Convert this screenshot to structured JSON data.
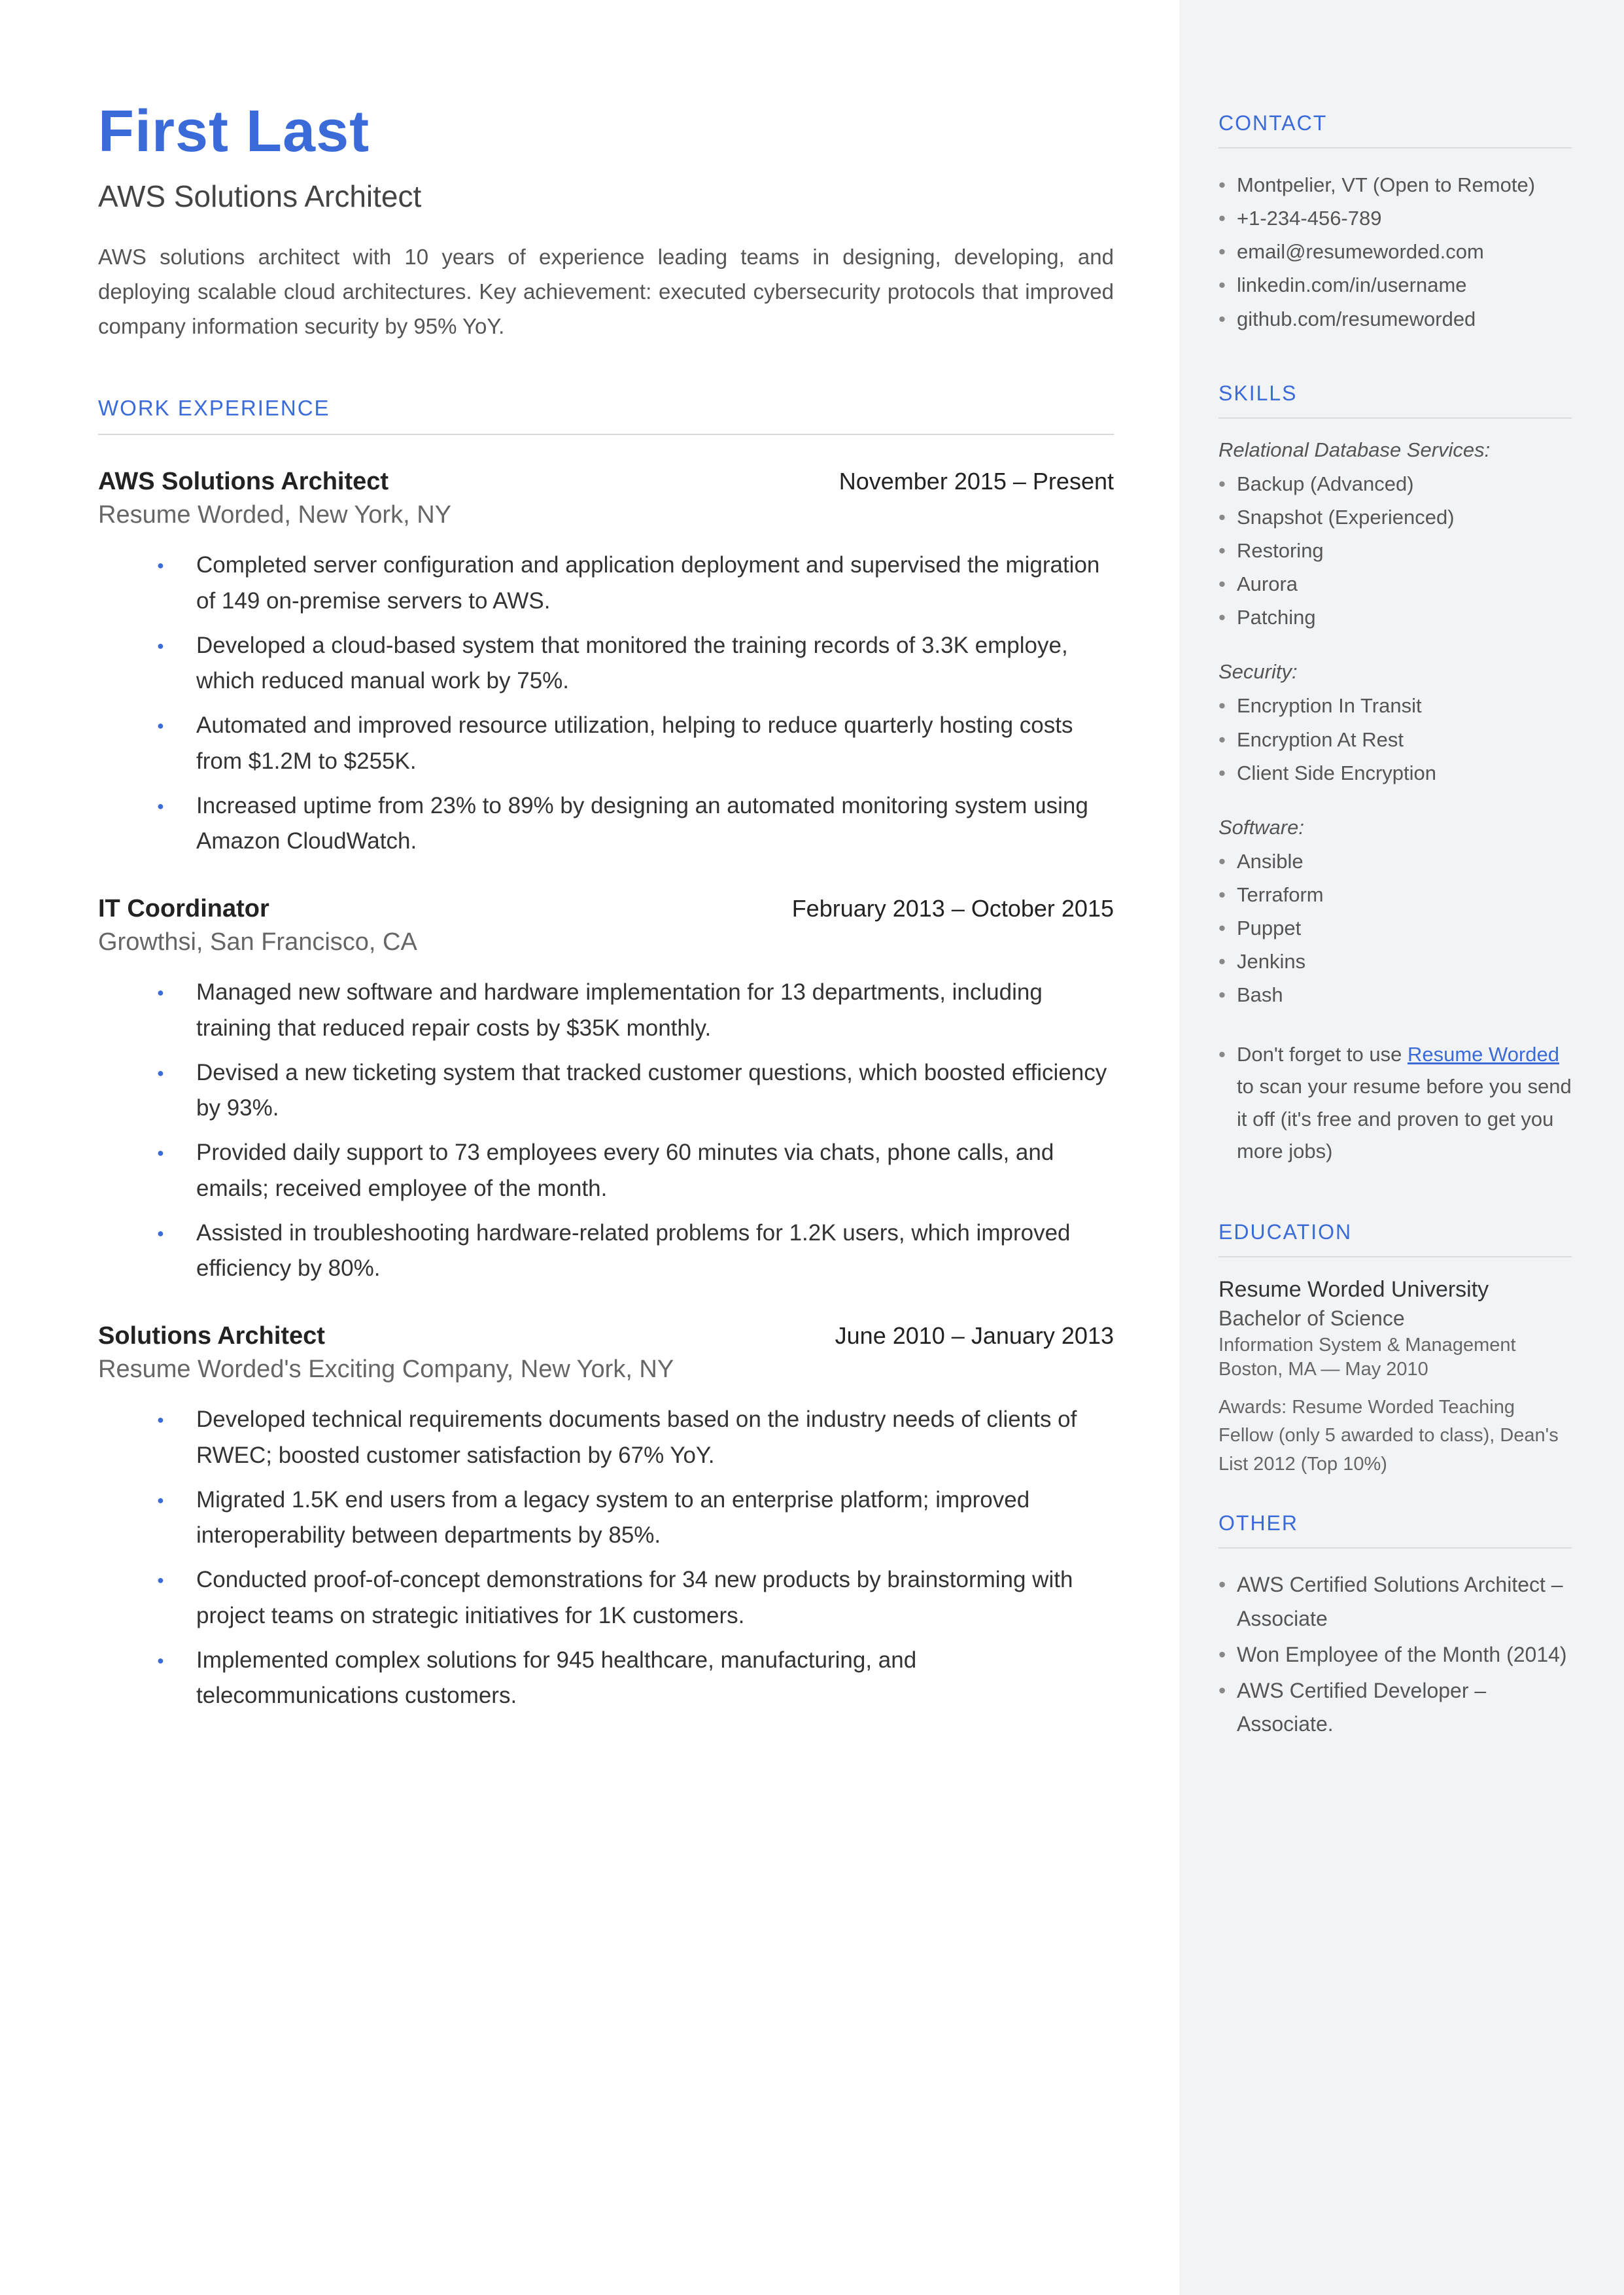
{
  "header": {
    "name": "First Last",
    "title": "AWS Solutions Architect",
    "summary": "AWS solutions architect with 10 years of experience leading teams in designing, developing, and deploying scalable cloud architectures. Key achievement: executed cybersecurity protocols that improved company information security by 95% YoY."
  },
  "sections": {
    "work": "WORK EXPERIENCE",
    "contact": "CONTACT",
    "skills": "SKILLS",
    "education": "EDUCATION",
    "other": "OTHER"
  },
  "jobs": [
    {
      "title": "AWS Solutions Architect",
      "dates": "November 2015 – Present",
      "company": "Resume Worded, New York, NY",
      "bullets": [
        "Completed server configuration and application deployment and supervised the migration of 149 on-premise servers to AWS.",
        "Developed a cloud-based system that monitored the training records of 3.3K employe, which reduced manual work by 75%.",
        "Automated and improved resource utilization, helping to reduce quarterly hosting costs from $1.2M to $255K.",
        "Increased uptime from 23% to 89% by designing an automated monitoring system using Amazon CloudWatch."
      ]
    },
    {
      "title": "IT Coordinator",
      "dates": "February 2013 – October 2015",
      "company": "Growthsi, San Francisco, CA",
      "bullets": [
        "Managed new software and hardware implementation for 13 departments, including training that reduced repair costs by $35K monthly.",
        "Devised a new ticketing system that tracked customer questions, which boosted efficiency by 93%.",
        "Provided daily support to 73 employees every 60 minutes via chats, phone calls, and emails; received employee of the month.",
        "Assisted in troubleshooting hardware-related problems for 1.2K users, which improved efficiency by 80%."
      ]
    },
    {
      "title": "Solutions Architect",
      "dates": "June 2010 – January 2013",
      "company": "Resume Worded's Exciting Company, New York, NY",
      "bullets": [
        "Developed technical requirements documents based on the industry needs of clients of RWEC; boosted customer satisfaction by 67% YoY.",
        "Migrated 1.5K end users from a legacy system to an enterprise platform; improved interoperability between departments by 85%.",
        "Conducted proof-of-concept demonstrations for 34 new products by brainstorming with project teams on strategic initiatives for 1K customers.",
        "Implemented complex solutions for 945 healthcare, manufacturing, and telecommunications customers."
      ]
    }
  ],
  "contact": [
    "Montpelier, VT (Open to Remote)",
    "+1-234-456-789",
    "email@resumeworded.com",
    "linkedin.com/in/username",
    "github.com/resumeworded"
  ],
  "skills": {
    "groups": [
      {
        "title": "Relational Database Services:",
        "items": [
          "Backup (Advanced)",
          "Snapshot (Experienced)",
          "Restoring",
          "Aurora",
          "Patching"
        ]
      },
      {
        "title": "Security:",
        "items": [
          "Encryption In Transit",
          "Encryption At Rest",
          "Client Side Encryption"
        ]
      },
      {
        "title": "Software:",
        "items": [
          "Ansible",
          "Terraform",
          "Puppet",
          "Jenkins",
          "Bash"
        ]
      }
    ],
    "note_prefix": "Don't forget to use ",
    "note_link": "Resume Worded",
    "note_suffix": " to scan your resume before you send it off (it's free and proven to get you more jobs)"
  },
  "education": {
    "school": "Resume Worded University",
    "degree": "Bachelor of Science",
    "field": "Information System & Management",
    "location": "Boston, MA — May 2010",
    "awards": "Awards: Resume Worded Teaching Fellow (only 5 awarded to class), Dean's List 2012 (Top 10%)"
  },
  "other": [
    "AWS Certified Solutions Architect – Associate",
    "Won Employee of the Month (2014)",
    "AWS Certified Developer – Associate."
  ]
}
